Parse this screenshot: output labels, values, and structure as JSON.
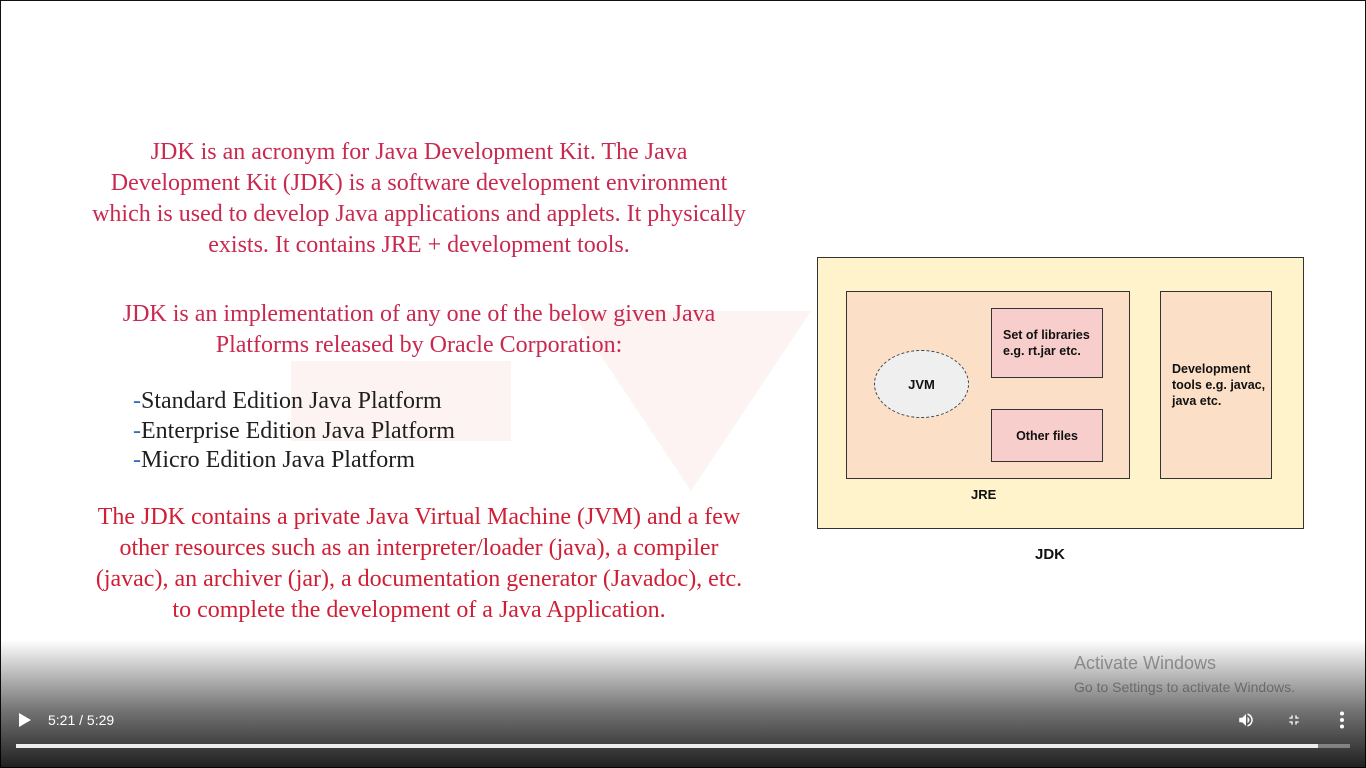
{
  "slide": {
    "para1": "JDK is an acronym for Java Development Kit. The Java Development Kit (JDK) is a software development environment which is used to develop Java applications and applets. It physically exists. It contains JRE + development tools.",
    "para2": "JDK is an implementation of any one of the below given Java Platforms released by Oracle Corporation:",
    "bullets": [
      "Standard Edition Java Platform",
      "Enterprise Edition Java Platform",
      "Micro Edition Java Platform"
    ],
    "bullet_dash": "-",
    "para3": "The JDK contains a private Java Virtual Machine (JVM) and a few other resources such as an interpreter/loader (java), a compiler (javac), an archiver (jar), a documentation generator (Javadoc), etc. to complete the development of a Java Application."
  },
  "diagram": {
    "jvm": "JVM",
    "libraries": "Set of libraries e.g. rt.jar etc.",
    "other_files": "Other files",
    "dev_tools": "Development tools e.g. javac, java etc.",
    "jre_label": "JRE",
    "jdk_label": "JDK",
    "colors": {
      "jdk_fill": "#fff3cc",
      "jre_fill": "#fbe0c7",
      "inner_fill": "#f8cecc",
      "jvm_fill": "#efefef"
    }
  },
  "watermark": {
    "line1": "Activate Windows",
    "line2": "Go to Settings to activate Windows."
  },
  "player": {
    "current_time": "5:21",
    "duration": "5:29",
    "time_display": "5:21 / 5:29",
    "progress": 0.976,
    "icons": {
      "play": "play-icon",
      "volume": "volume-icon",
      "fullscreen": "exit-fullscreen-icon",
      "more": "more-options-icon"
    }
  },
  "colors": {
    "heading_text": "#c9294f",
    "body_red": "#d01e35",
    "bullet_text": "#1f1f1f",
    "bullet_dash": "#2e6fb8"
  }
}
